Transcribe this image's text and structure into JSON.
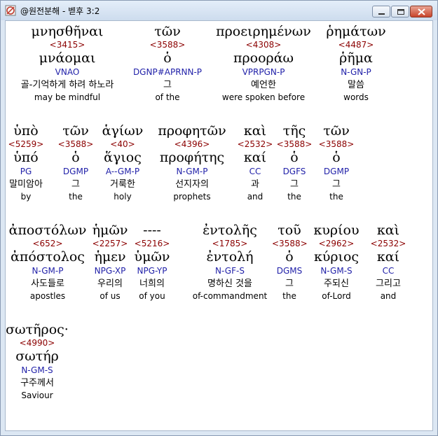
{
  "window": {
    "title": "@원전분해 - 벧후 3:2",
    "buttons": {
      "minimize": "minimize",
      "maximize": "maximize",
      "close": "close"
    }
  },
  "verse": {
    "rows": [
      [
        {
          "greek": "μνησθῆναι",
          "strong": "<3415>",
          "lexeme": "μνάομαι",
          "parse": "VNAO",
          "korean": "골-기억하게 하려 하노라",
          "english": "may be mindful"
        },
        {
          "greek": "τῶν",
          "strong": "<3588>",
          "lexeme": "ὁ",
          "parse": "DGNP#APRNN-P",
          "korean": "그",
          "english": "of the"
        },
        {
          "greek": "προειρημένων",
          "strong": "<4308>",
          "lexeme": "προοράω",
          "parse": "VPRPGN-P",
          "korean": "예언한",
          "english": "were spoken before"
        },
        {
          "greek": "ῥημάτων",
          "strong": "<4487>",
          "lexeme": "ῥῆμα",
          "parse": "N-GN-P",
          "korean": "말씀",
          "english": "words"
        }
      ],
      [
        {
          "greek": "ὑπὸ",
          "strong": "<5259>",
          "lexeme": "ὑπό",
          "parse": "PG",
          "korean": "말미암아",
          "english": "by"
        },
        {
          "greek": "τῶν",
          "strong": "<3588>",
          "lexeme": "ὁ",
          "parse": "DGMP",
          "korean": "그",
          "english": "the"
        },
        {
          "greek": "ἁγίων",
          "strong": "<40>",
          "lexeme": "ἅγιος",
          "parse": "A--GM-P",
          "korean": "거룩한",
          "english": "holy"
        },
        {
          "greek": "προφητῶν",
          "strong": "<4396>",
          "lexeme": "προφήτης",
          "parse": "N-GM-P",
          "korean": "선지자의",
          "english": "prophets"
        },
        {
          "greek": "καὶ",
          "strong": "<2532>",
          "lexeme": "καί",
          "parse": "CC",
          "korean": "과",
          "english": "and"
        },
        {
          "greek": "τῆς",
          "strong": "<3588>",
          "lexeme": "ὁ",
          "parse": "DGFS",
          "korean": "그",
          "english": "the"
        },
        {
          "greek": "τῶν",
          "strong": "<3588>",
          "lexeme": "ὁ",
          "parse": "DGMP",
          "korean": "그",
          "english": "the"
        }
      ],
      [
        {
          "greek": "ἀποστόλων",
          "strong": "<652>",
          "lexeme": "ἀπόστολος",
          "parse": "N-GM-P",
          "korean": "사도들로",
          "english": "apostles"
        },
        {
          "greek": "ἡμῶν",
          "strong": "<2257>",
          "lexeme": "ἡμεν",
          "parse": "NPG-XP",
          "korean": "우리의",
          "english": "of us"
        },
        {
          "greek": "----",
          "strong": "<5216>",
          "lexeme": "ὑμῶν",
          "parse": "NPG-YP",
          "korean": "너희의",
          "english": "of you"
        },
        {
          "greek": "ἐντολῆς",
          "strong": "<1785>",
          "lexeme": "ἐντολή",
          "parse": "N-GF-S",
          "korean": "명하신 것을",
          "english": "of-commandment"
        },
        {
          "greek": "τοῦ",
          "strong": "<3588>",
          "lexeme": "ὁ",
          "parse": "DGMS",
          "korean": "그",
          "english": "the"
        },
        {
          "greek": "κυρίου",
          "strong": "<2962>",
          "lexeme": "κύριος",
          "parse": "N-GM-S",
          "korean": "주되신",
          "english": "of-Lord"
        },
        {
          "greek": "καὶ",
          "strong": "<2532>",
          "lexeme": "καί",
          "parse": "CC",
          "korean": "그리고",
          "english": "and"
        }
      ],
      [
        {
          "greek": "σωτῆρος·",
          "strong": "<4990>",
          "lexeme": "σωτήρ",
          "parse": "N-GM-S",
          "korean": "구주께서",
          "english": "Saviour"
        }
      ]
    ]
  },
  "colors": {
    "strong": "#8b0000",
    "parse": "#1f1fa8",
    "text": "#000000"
  }
}
